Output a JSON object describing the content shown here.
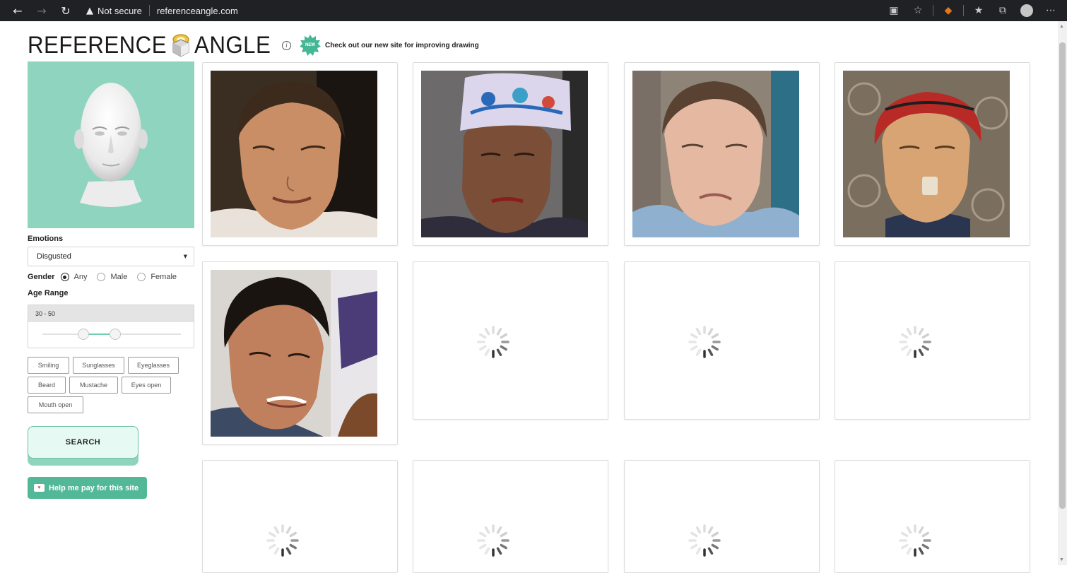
{
  "browser": {
    "security_label": "Not secure",
    "url": "referenceangle.com",
    "back_icon": "back-arrow-icon",
    "forward_icon": "forward-arrow-icon",
    "reload_icon": "reload-icon"
  },
  "header": {
    "logo_left": "REFERENCE",
    "logo_right": "ANGLE",
    "info_glyph": "i",
    "new_badge": "NEW",
    "promo_text": "Check out our new site for improving drawing"
  },
  "filters": {
    "emotions_label": "Emotions",
    "emotion_selected": "Disgusted",
    "gender_label": "Gender",
    "gender_options": [
      "Any",
      "Male",
      "Female"
    ],
    "gender_selected": "Any",
    "age_label": "Age Range",
    "age_value": "30 - 50",
    "age_min": 30,
    "age_max": 50,
    "tags": [
      "Smiling",
      "Sunglasses",
      "Eyeglasses",
      "Beard",
      "Mustache",
      "Eyes open",
      "Mouth open"
    ],
    "search_label": "SEARCH",
    "support_label": "Help me pay for this site"
  },
  "colors": {
    "accent": "#8fd4bf",
    "button_green": "#52b898",
    "chrome_bg": "#202124"
  },
  "results": {
    "loaded_count": 5,
    "loading_count": 7
  }
}
